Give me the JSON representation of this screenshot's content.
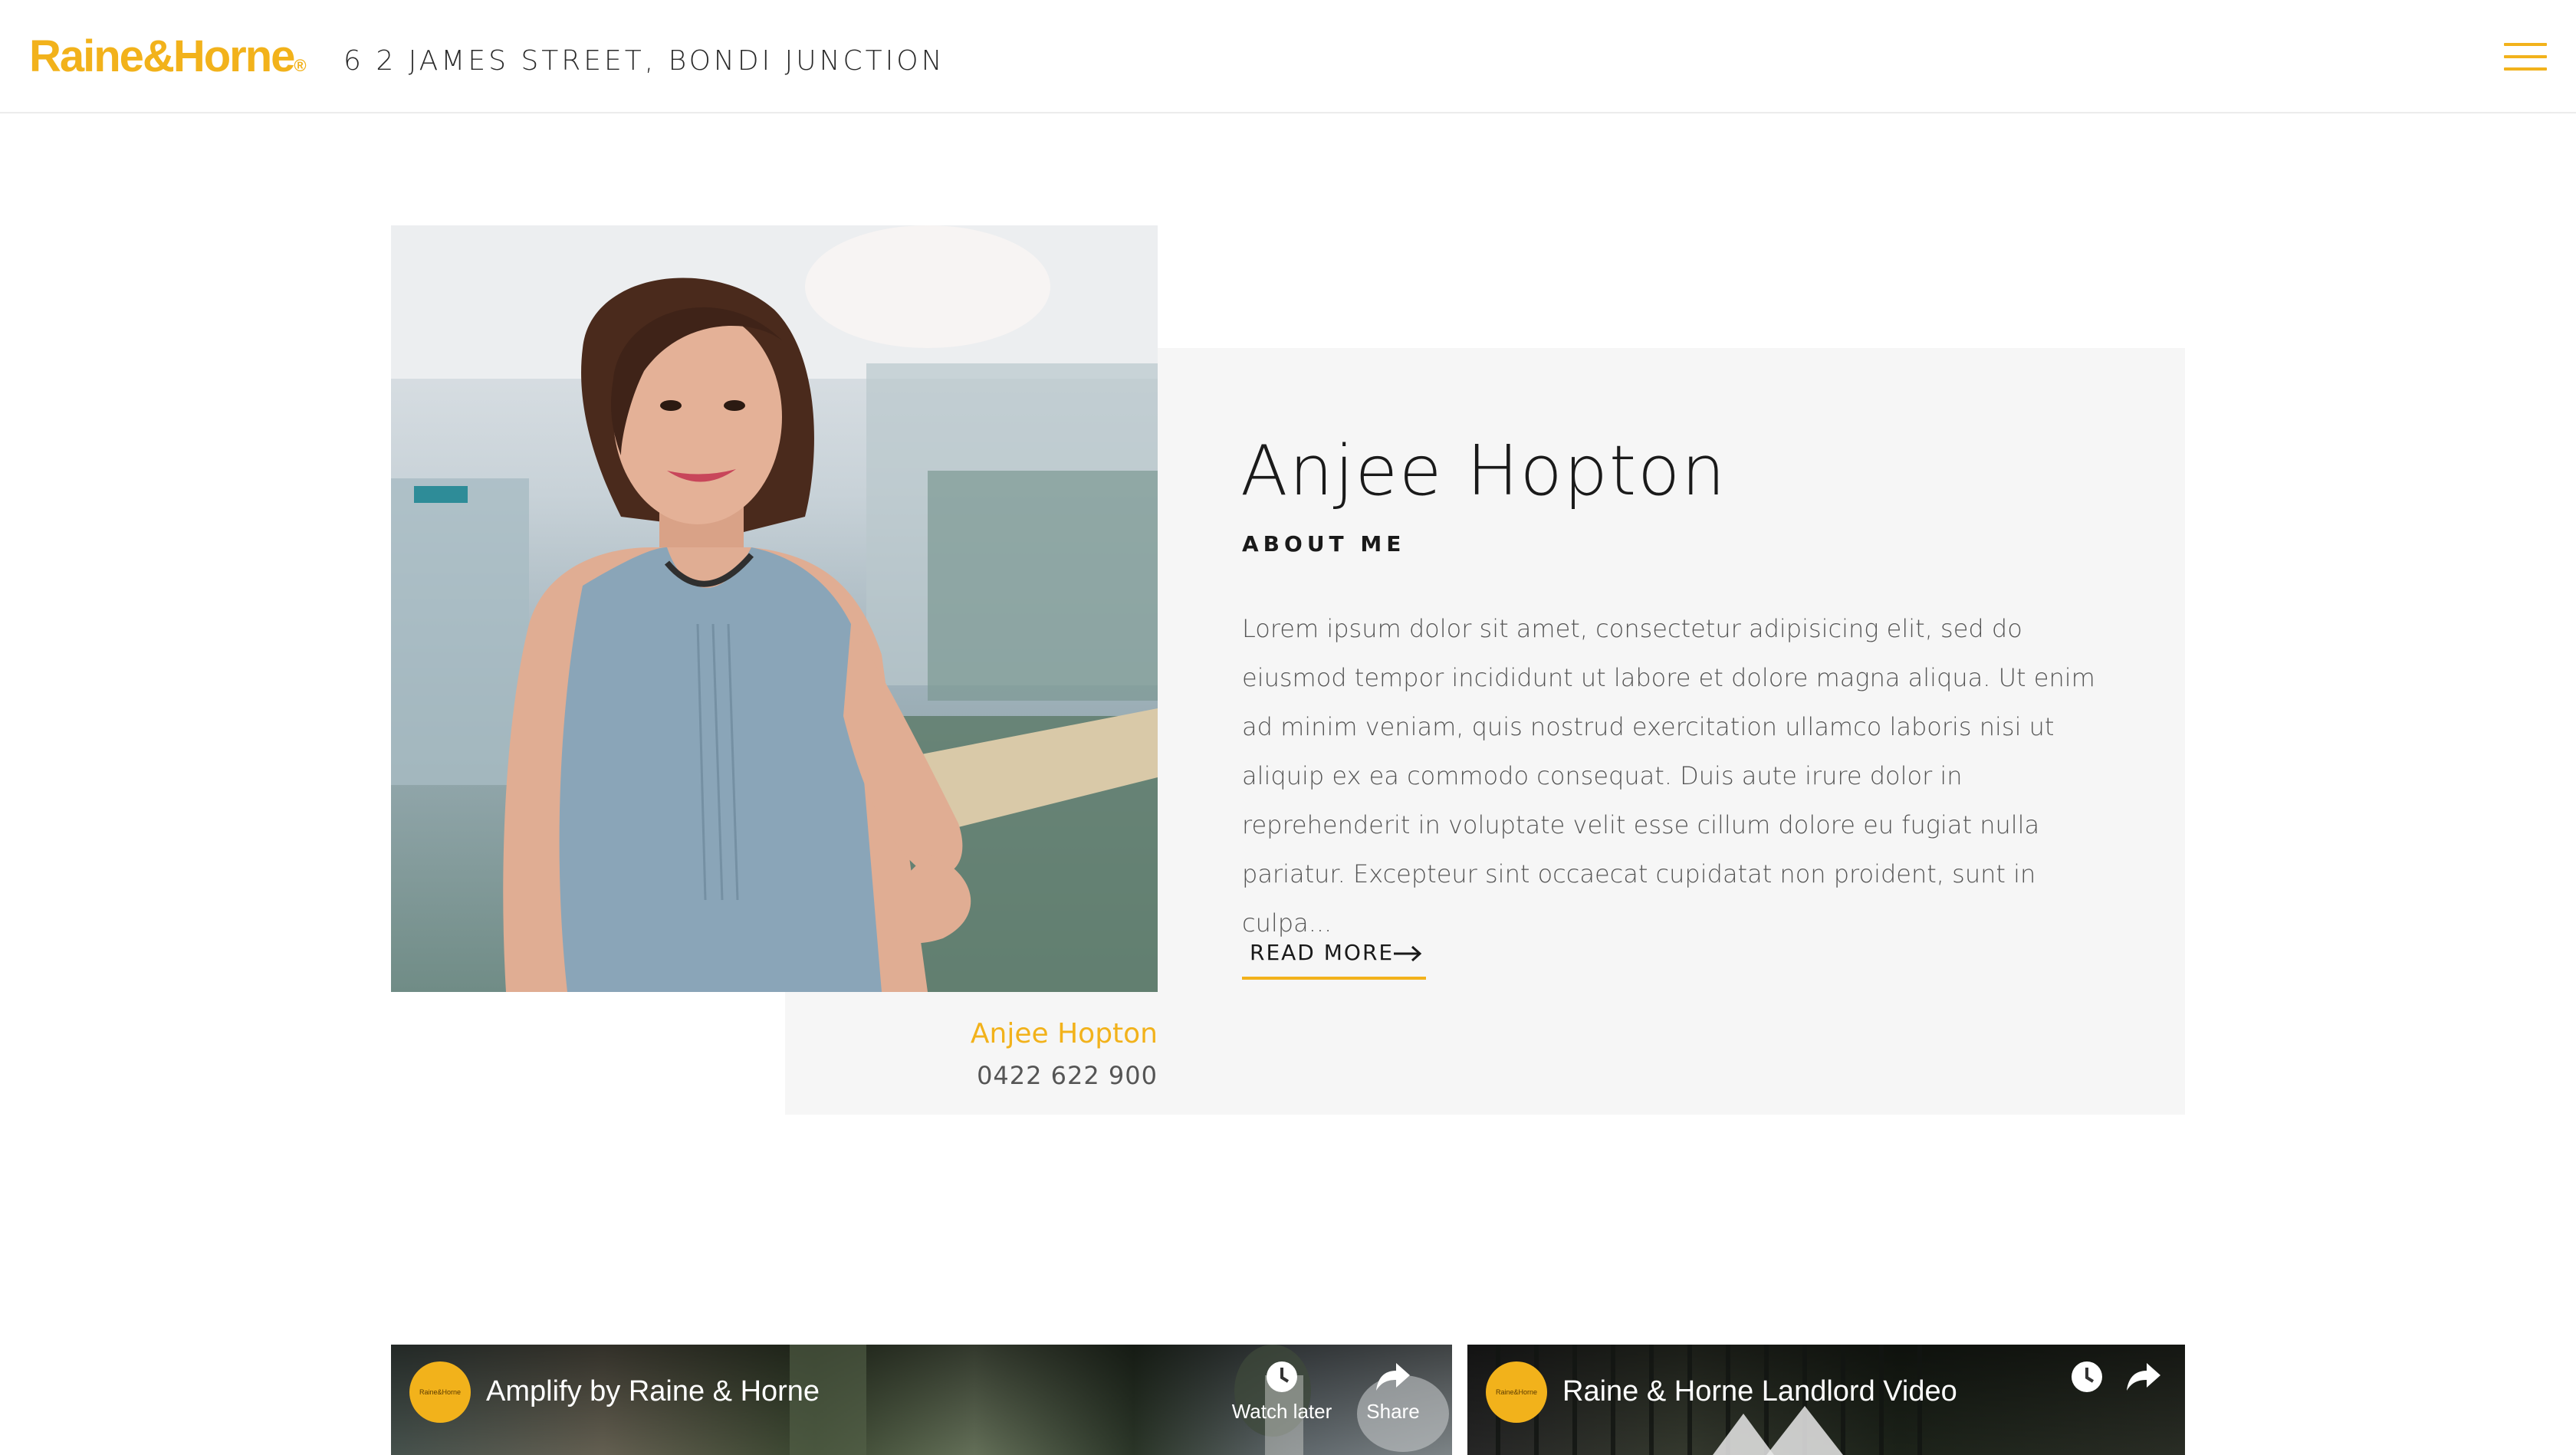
{
  "header": {
    "logo_text": "Raine&Horne",
    "logo_mark": "®",
    "office_name": "6 2 JAMES STREET, BONDI JUNCTION",
    "menu_icon": "hamburger-menu-icon"
  },
  "profile": {
    "name": "Anjee Hopton",
    "section_label": "ABOUT ME",
    "bio": "Lorem ipsum dolor sit amet, consectetur adipisicing elit, sed do eiusmod tempor incididunt ut labore et dolore magna aliqua. Ut enim ad minim veniam, quis nostrud exercitation ullamco laboris nisi ut aliquip ex ea commodo consequat. Duis aute irure dolor in reprehenderit in voluptate velit esse cillum dolore eu fugiat nulla pariatur. Excepteur sint occaecat cupidatat non proident, sunt in culpa...",
    "read_more_label": "READ MORE",
    "caption_name": "Anjee Hopton",
    "caption_phone": "0422 622 900"
  },
  "videos": [
    {
      "title": "Amplify by Raine & Horne",
      "channel_avatar_text": "Raine&Horne",
      "watch_later_label": "Watch later",
      "share_label": "Share"
    },
    {
      "title": "Raine & Horne Landlord Video",
      "channel_avatar_text": "Raine&Horne"
    }
  ],
  "colors": {
    "brand": "#f2b21b",
    "panel": "#f6f6f6",
    "text": "#1a1a1a",
    "muted": "#555555"
  }
}
